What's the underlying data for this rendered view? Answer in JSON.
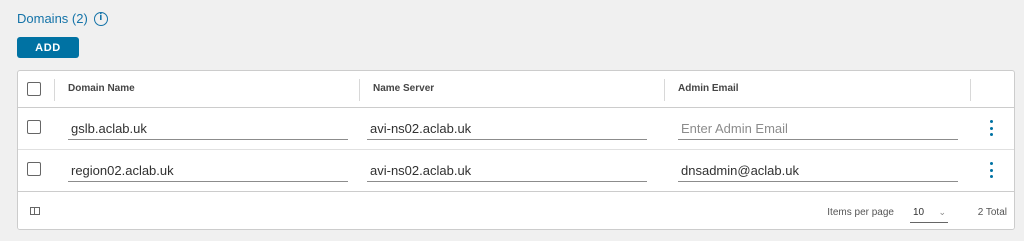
{
  "section": {
    "title": "Domains (2)",
    "info_icon": "info-icon"
  },
  "toolbar": {
    "add_label": "ADD"
  },
  "table": {
    "columns": [
      "Domain Name",
      "Name Server",
      "Admin Email"
    ],
    "rows": [
      {
        "domain_name": "gslb.aclab.uk",
        "name_server": "avi-ns02.aclab.uk",
        "admin_email": "",
        "admin_email_placeholder": "Enter Admin Email"
      },
      {
        "domain_name": "region02.aclab.uk",
        "name_server": "avi-ns02.aclab.uk",
        "admin_email": "dnsadmin@aclab.uk",
        "admin_email_placeholder": ""
      }
    ]
  },
  "footer": {
    "items_per_page_label": "Items per page",
    "items_per_page_value": "10",
    "total_label": "2 Total"
  },
  "colors": {
    "accent": "#0072a3",
    "title": "#1473a8"
  }
}
